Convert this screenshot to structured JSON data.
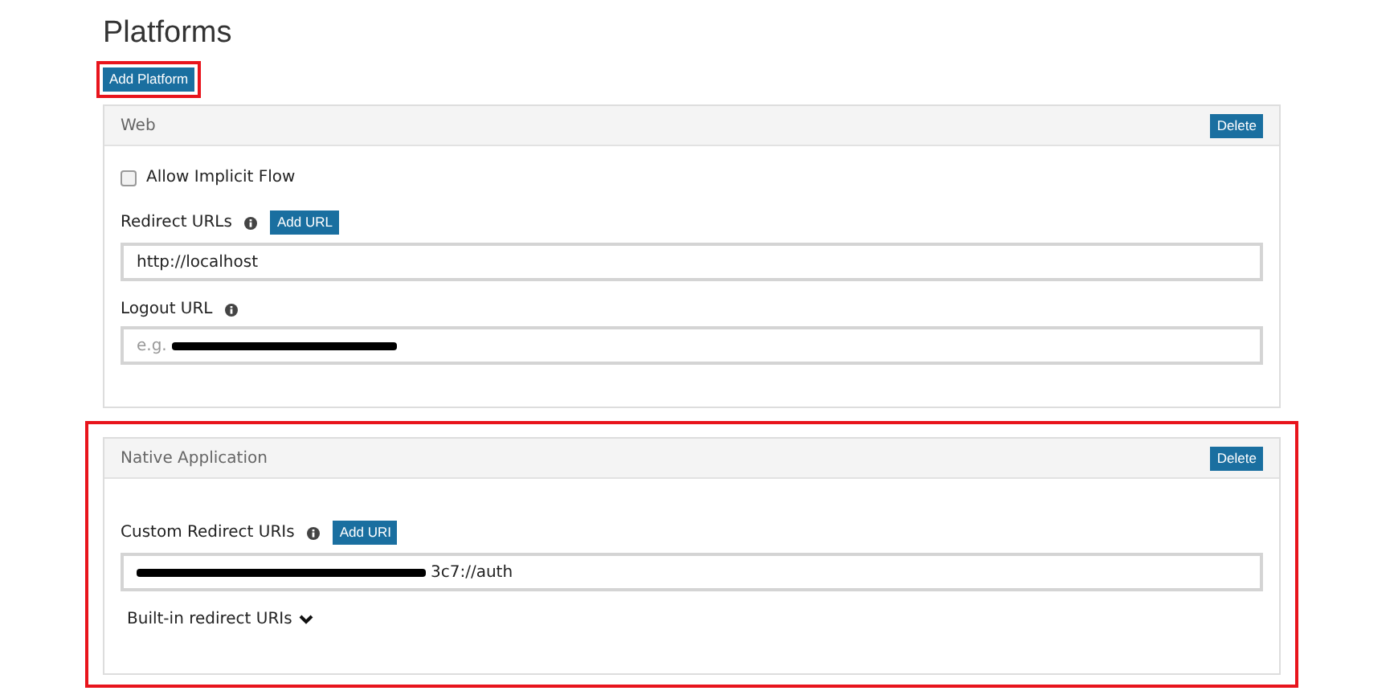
{
  "title": "Platforms",
  "add_button": {
    "label": "Add Platform",
    "highlighted": true
  },
  "platforms": [
    {
      "name": "Web",
      "delete_label": "Delete",
      "highlighted": false,
      "fields": [
        {
          "kind": "checkbox",
          "label": "Allow Implicit Flow",
          "checked": false
        },
        {
          "kind": "url",
          "label": "Redirect URLs",
          "info": true,
          "add_label": "Add URL",
          "value": "http://localhost",
          "redacted": false
        },
        {
          "kind": "url",
          "label": "Logout URL",
          "info": true,
          "placeholder": "e.g.",
          "redacted": true
        }
      ]
    },
    {
      "name": "Native Application",
      "delete_label": "Delete",
      "highlighted": true,
      "fields": [
        {
          "kind": "url",
          "label": "Custom Redirect URIs",
          "info": true,
          "add_label": "Add URI",
          "value": "3c7://auth",
          "redacted": true
        },
        {
          "kind": "expander",
          "label": "Built-in redirect URIs",
          "expanded": false
        }
      ]
    }
  ]
}
